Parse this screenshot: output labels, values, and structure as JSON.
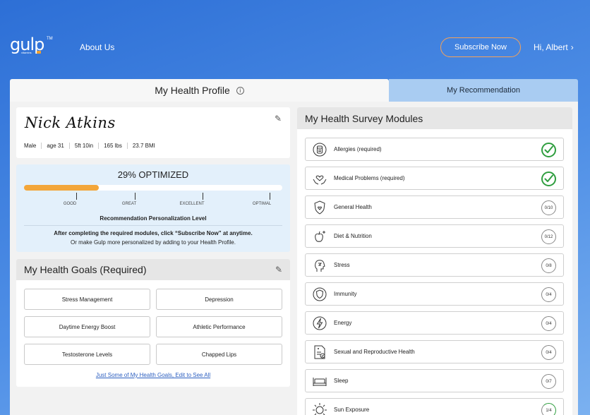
{
  "header": {
    "logo_word": "gulp",
    "logo_tm": "TM",
    "logo_sub": "vitamins",
    "about_label": "About Us",
    "subscribe_label": "Subscribe Now",
    "greeting": "Hi, Albert",
    "greeting_chevron": "›",
    "accent_color": "#f5a25a"
  },
  "tabs": {
    "profile_label": "My Health Profile",
    "info_glyph": "i",
    "recommendation_label": "My Recommendation"
  },
  "profile": {
    "signature": "Nick Atkins",
    "edit_glyph": "✎",
    "stats": [
      "Male",
      "age 31",
      "5ft 10in",
      "165 lbs",
      "23.7 BMI"
    ]
  },
  "optimization": {
    "title": "29% OPTIMIZED",
    "progress_percent": 29,
    "fill_color": "#f3a63a",
    "levels": [
      "GOOD",
      "GREAT",
      "EXCELLENT",
      "OPTIMAL"
    ],
    "caption": "Recommendation Personalization Level",
    "note_bold": "After completing the required modules, click “Subscribe Now” at anytime.",
    "note": "Or make Gulp more personalized by adding to your Health Profile."
  },
  "goals": {
    "title": "My Health Goals (Required)",
    "items": [
      "Stress Management",
      "Depression",
      "Daytime Energy Boost",
      "Athletic Performance",
      "Testosterone Levels",
      "Chapped Lips"
    ],
    "link": "Just Some of My Health Goals, Edit to See All"
  },
  "survey": {
    "title": "My Health Survey Modules",
    "done_color": "#2f9e3f",
    "modules": [
      {
        "label": "Allergies (required)",
        "status": "done",
        "icon": "pill-bottle-icon"
      },
      {
        "label": "Medical Problems (required)",
        "status": "done",
        "icon": "heart-hands-icon"
      },
      {
        "label": "General Health",
        "status": "0/10",
        "icon": "shield-heart-icon"
      },
      {
        "label": "Diet & Nutrition",
        "status": "0/12",
        "icon": "apple-icon"
      },
      {
        "label": "Stress",
        "status": "0/8",
        "icon": "head-stress-icon"
      },
      {
        "label": "Immunity",
        "status": "0/4",
        "icon": "immunity-shield-icon"
      },
      {
        "label": "Energy",
        "status": "0/4",
        "icon": "lightning-icon"
      },
      {
        "label": "Sexual and Reproductive Health",
        "status": "0/4",
        "icon": "document-health-icon"
      },
      {
        "label": "Sleep",
        "status": "0/7",
        "icon": "bed-icon"
      },
      {
        "label": "Sun Exposure",
        "status": "1/4",
        "icon": "sun-icon"
      }
    ]
  }
}
